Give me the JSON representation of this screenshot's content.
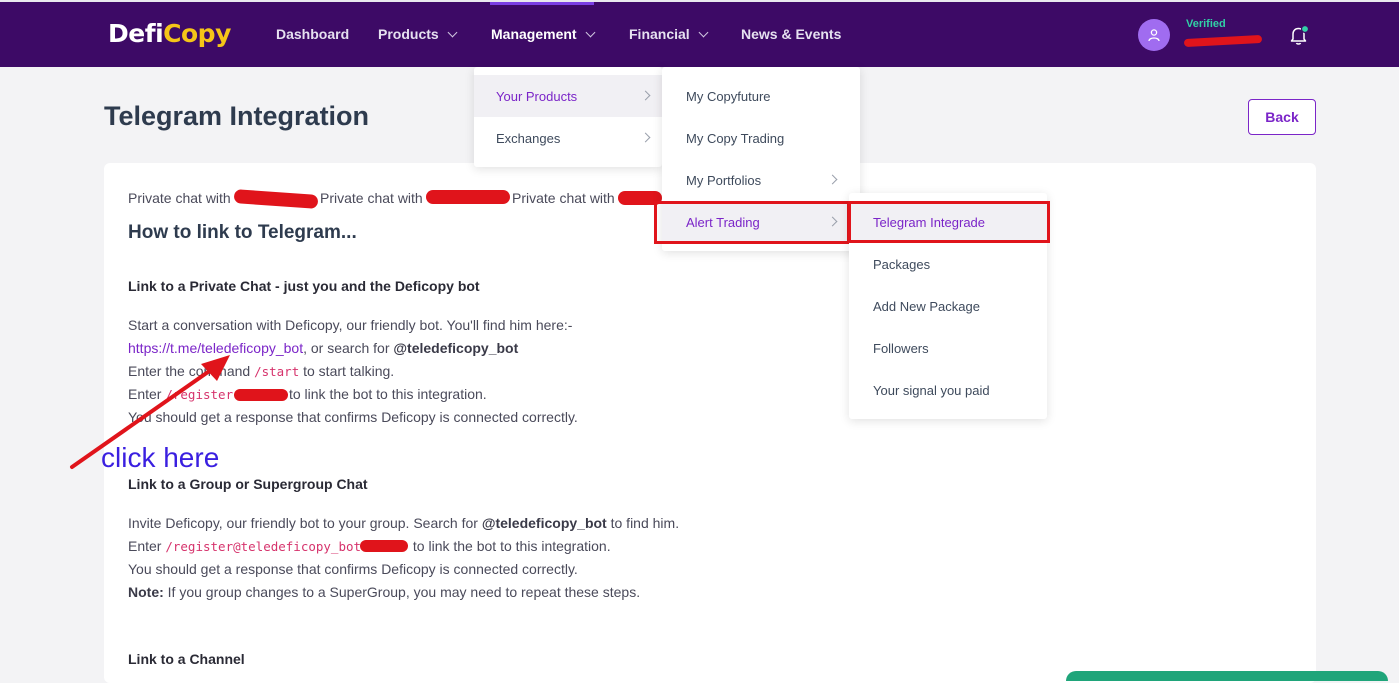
{
  "brand": {
    "part1": "Defi",
    "part2": "Copy"
  },
  "nav": {
    "dashboard": "Dashboard",
    "products": "Products",
    "management": "Management",
    "financial": "Financial",
    "news": "News & Events"
  },
  "user": {
    "status": "Verified"
  },
  "page": {
    "title": "Telegram Integration",
    "back_label": "Back"
  },
  "content": {
    "private_chat_label": "Private chat with",
    "heading": "How to link to Telegram...",
    "section1_title": "Link to a Private Chat - just you and the Deficopy bot",
    "s1_line1": "Start a conversation with Deficopy, our friendly bot. You'll find him here:-",
    "s1_link": "https://t.me/teledeficopy_bot",
    "s1_line2_mid": ", or search for",
    "s1_bot_handle": "@teledeficopy_bot",
    "s1_line3_pre": "Enter the command",
    "s1_cmd_start": "/start",
    "s1_line3_post": "to start talking.",
    "s1_line4_pre": "Enter",
    "s1_cmd_register": "/register",
    "s1_line4_post": "to link the bot to this integration.",
    "s1_line5": "You should get a response that confirms Deficopy is connected correctly.",
    "section2_title": "Link to a Group or Supergroup Chat",
    "s2_line1_pre": "Invite Deficopy, our friendly bot to your group. Search for",
    "s2_bot_handle": "@teledeficopy_bot",
    "s2_line1_post": "to find him.",
    "s2_line2_pre": "Enter",
    "s2_cmd": "/register@teledeficopy_bot",
    "s2_line2_post": "to link the bot to this integration.",
    "s2_line3": "You should get a response that confirms Deficopy is connected correctly.",
    "s2_note_label": "Note:",
    "s2_note": "If you group changes to a SuperGroup, you may need to repeat these steps.",
    "section3_title": "Link to a Channel"
  },
  "annotation": {
    "click_here": "click here"
  },
  "menus": {
    "level1": [
      "Your Products",
      "Exchanges"
    ],
    "level2": [
      "My Copyfuture",
      "My Copy Trading",
      "My Portfolios",
      "Alert Trading"
    ],
    "level3": [
      "Telegram Integrade",
      "Packages",
      "Add New Package",
      "Followers",
      "Your signal you paid"
    ]
  },
  "colors": {
    "nav_bg": "#3d0a66",
    "accent": "#7b25c8",
    "verified": "#31d0a6",
    "annotation_red": "#e0141b",
    "annotation_blue": "#3a1fe0"
  }
}
